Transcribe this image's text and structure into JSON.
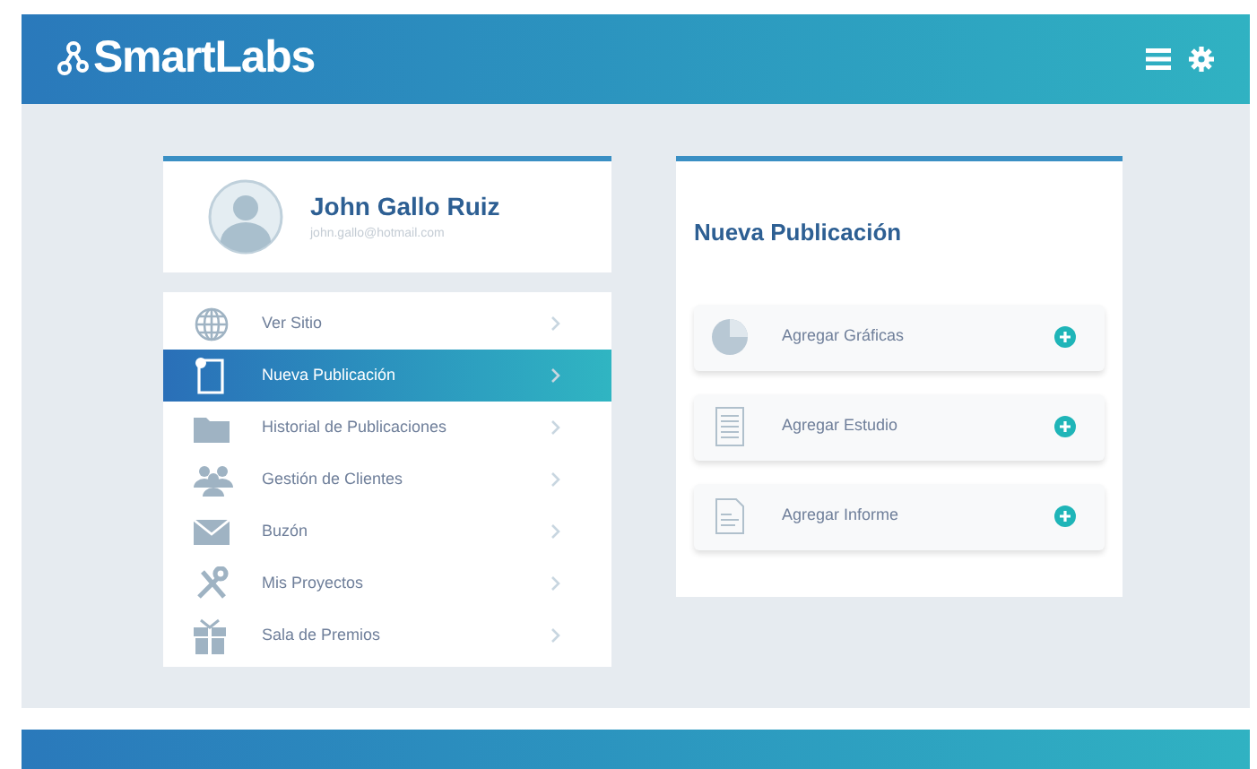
{
  "header": {
    "logo": "SmartLabs"
  },
  "profile": {
    "name": "John Gallo Ruiz",
    "email": "john.gallo@hotmail.com"
  },
  "menu": [
    {
      "label": "Ver Sitio",
      "selected": false
    },
    {
      "label": "Nueva Publicación",
      "selected": true
    },
    {
      "label": "Historial de Publicaciones",
      "selected": false
    },
    {
      "label": "Gestión de Clientes",
      "selected": false
    },
    {
      "label": "Buzón",
      "selected": false
    },
    {
      "label": "Mis Proyectos",
      "selected": false
    },
    {
      "label": "Sala de Premios",
      "selected": false
    }
  ],
  "panel": {
    "title": "Nueva Publicación",
    "actions": [
      {
        "label": "Agregar Gráficas"
      },
      {
        "label": "Agregar Estudio"
      },
      {
        "label": "Agregar Informe"
      }
    ]
  }
}
